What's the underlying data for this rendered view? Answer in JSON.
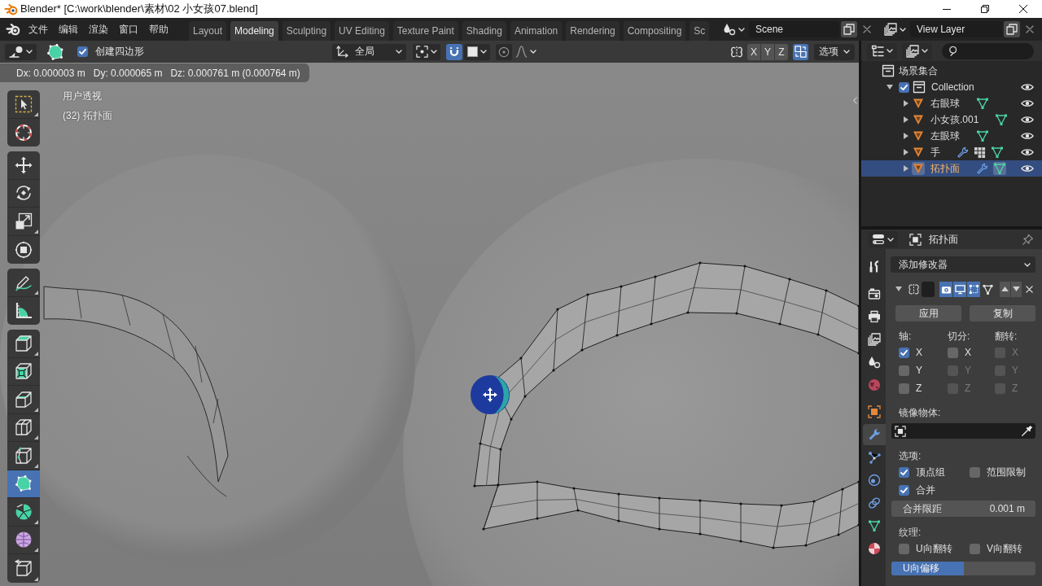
{
  "window": {
    "title": "Blender* [C:\\work\\blender\\素材\\02 小女孩07.blend]"
  },
  "top_bar": {
    "menus": [
      "文件",
      "编辑",
      "渲染",
      "窗口",
      "帮助"
    ],
    "workspaces": [
      {
        "label": "Layout",
        "selected": false
      },
      {
        "label": "Modeling",
        "selected": true
      },
      {
        "label": "Sculpting",
        "selected": false
      },
      {
        "label": "UV Editing",
        "selected": false
      },
      {
        "label": "Texture Paint",
        "selected": false
      },
      {
        "label": "Shading",
        "selected": false
      },
      {
        "label": "Animation",
        "selected": false
      },
      {
        "label": "Rendering",
        "selected": false
      },
      {
        "label": "Compositing",
        "selected": false
      },
      {
        "label": "Sc",
        "selected": false
      }
    ],
    "scene": "Scene",
    "view_layer": "View Layer"
  },
  "viewport_header": {
    "tool_settings": [
      {
        "label": "创建四边形",
        "checked": true
      }
    ],
    "orientation": "全局",
    "snap_on": true,
    "proportional_on": false,
    "mirror_axes": [
      {
        "label": "X",
        "on": false
      },
      {
        "label": "Y",
        "on": false
      },
      {
        "label": "Z",
        "on": false
      }
    ],
    "auto_merge_on": true,
    "options_menu": "选项"
  },
  "operator_status": [
    "Dx: 0.000003 m",
    "Dy: 0.000065 m",
    "Dz: 0.000761 m (0.000764 m)"
  ],
  "viewport": {
    "view_name": "用户透视",
    "object_info": "(32) 拓扑面",
    "toolbar": [
      [
        {
          "kind": "select_box",
          "selected": false,
          "more": true
        },
        {
          "kind": "cursor",
          "selected": false,
          "more": false
        }
      ],
      [
        {
          "kind": "move",
          "selected": false,
          "more": false
        },
        {
          "kind": "rotate",
          "selected": false,
          "more": false
        },
        {
          "kind": "scale",
          "selected": false,
          "more": true
        },
        {
          "kind": "transform",
          "selected": false,
          "more": false
        }
      ],
      [
        {
          "kind": "annotate",
          "selected": false,
          "more": true
        },
        {
          "kind": "measure",
          "selected": false,
          "more": false
        }
      ],
      [
        {
          "kind": "extrude",
          "selected": false,
          "more": true
        },
        {
          "kind": "inset",
          "selected": false,
          "more": false
        },
        {
          "kind": "bevel",
          "selected": false,
          "more": true
        },
        {
          "kind": "loop_cut",
          "selected": false,
          "more": true
        },
        {
          "kind": "knife",
          "selected": false,
          "more": true
        },
        {
          "kind": "poly_build",
          "selected": true,
          "more": false
        },
        {
          "kind": "spin",
          "selected": false,
          "more": true
        },
        {
          "kind": "smooth",
          "selected": false,
          "more": true
        },
        {
          "kind": "shrink",
          "selected": false,
          "more": true
        }
      ]
    ]
  },
  "outliner": {
    "tree": [
      {
        "kind": "scene_collection",
        "label": "场景集合",
        "children": [
          {
            "kind": "collection",
            "label": "Collection",
            "expanded": true,
            "checked": true,
            "children": [
              {
                "kind": "object",
                "label": "右眼球",
                "expanded": false,
                "selected": false,
                "modifiers": false,
                "vertex_groups": false
              },
              {
                "kind": "object",
                "label": "小女孩.001",
                "expanded": false,
                "selected": false,
                "modifiers": false,
                "vertex_groups": false
              },
              {
                "kind": "object",
                "label": "左眼球",
                "expanded": false,
                "selected": false,
                "modifiers": false,
                "vertex_groups": false
              },
              {
                "kind": "object",
                "label": "手",
                "expanded": false,
                "selected": false,
                "modifiers": true,
                "vertex_groups": true
              },
              {
                "kind": "object",
                "label": "拓扑面",
                "expanded": false,
                "selected": true,
                "modifiers": true,
                "vertex_groups": false
              }
            ]
          }
        ]
      }
    ]
  },
  "properties": {
    "object_name": "拓扑面",
    "tabs": [
      [
        {
          "kind": "tool",
          "selected": false
        }
      ],
      [
        {
          "kind": "render",
          "selected": false
        },
        {
          "kind": "output",
          "selected": false
        },
        {
          "kind": "view_layer",
          "selected": false
        },
        {
          "kind": "scene",
          "selected": false
        },
        {
          "kind": "world",
          "selected": false
        }
      ],
      [
        {
          "kind": "object",
          "selected": false
        },
        {
          "kind": "modifiers",
          "selected": true
        },
        {
          "kind": "particles",
          "selected": false
        },
        {
          "kind": "physics",
          "selected": false
        },
        {
          "kind": "constraints",
          "selected": false
        },
        {
          "kind": "data",
          "selected": false
        },
        {
          "kind": "material",
          "selected": false
        }
      ]
    ],
    "add_modifier": "添加修改器",
    "modifier": {
      "expanded": true,
      "toggles": [
        {
          "kind": "render",
          "on": true
        },
        {
          "kind": "realtime",
          "on": true
        },
        {
          "kind": "edit_mode",
          "on": true
        },
        {
          "kind": "on_cage",
          "on": false
        }
      ],
      "buttons": [
        "应用",
        "复制"
      ],
      "columns": [
        {
          "heading": "轴:",
          "options": [
            {
              "label": "X",
              "checked": true,
              "disabled": false
            },
            {
              "label": "Y",
              "checked": false,
              "disabled": false
            },
            {
              "label": "Z",
              "checked": false,
              "disabled": false
            }
          ]
        },
        {
          "heading": "切分:",
          "options": [
            {
              "label": "X",
              "checked": false,
              "disabled": false
            },
            {
              "label": "Y",
              "checked": false,
              "disabled": true
            },
            {
              "label": "Z",
              "checked": false,
              "disabled": true
            }
          ]
        },
        {
          "heading": "翻转:",
          "options": [
            {
              "label": "X",
              "checked": false,
              "disabled": true
            },
            {
              "label": "Y",
              "checked": false,
              "disabled": true
            },
            {
              "label": "Z",
              "checked": false,
              "disabled": true
            }
          ]
        }
      ],
      "mirror_object_label": "镜像物体:",
      "options_heading": "选项:",
      "options": [
        {
          "label": "顶点组",
          "checked": true
        },
        {
          "label": "范围限制",
          "checked": false
        },
        {
          "label": "合并",
          "checked": true
        }
      ],
      "merge_limit": {
        "label": "合并限距",
        "value": "0.001 m"
      },
      "texture_heading": "纹理:",
      "texture_options": [
        {
          "label": "U向翻转",
          "checked": false
        },
        {
          "label": "V向翻转",
          "checked": false
        }
      ],
      "u_offset": {
        "label": "U向偏移",
        "level": 0.5
      }
    }
  }
}
